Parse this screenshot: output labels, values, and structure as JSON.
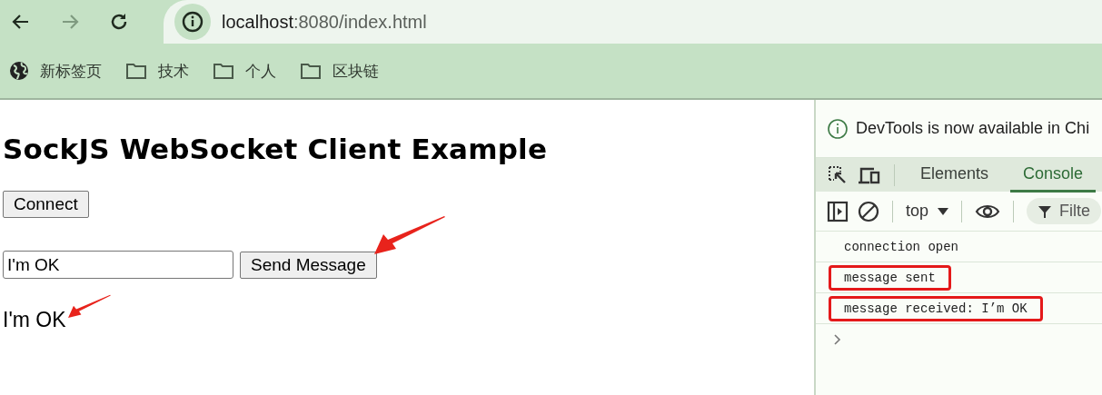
{
  "browser": {
    "nav": {
      "back_disabled": false,
      "forward_disabled": true
    },
    "address": {
      "host": "localhost",
      "rest": ":8080/index.html"
    },
    "bookmarks": [
      {
        "label": "新标签页",
        "kind": "globe"
      },
      {
        "label": "技术",
        "kind": "folder"
      },
      {
        "label": "个人",
        "kind": "folder"
      },
      {
        "label": "区块链",
        "kind": "folder"
      }
    ]
  },
  "page": {
    "heading": "SockJS WebSocket Client Example",
    "connect_button": {
      "label": "Connect"
    },
    "message_input": {
      "value": "I'm OK"
    },
    "send_button": {
      "label": "Send Message",
      "arrow": true
    },
    "received": {
      "text": "I'm OK",
      "arrow": true
    }
  },
  "devtools": {
    "notice": "DevTools is now available in Chi",
    "tabs": [
      {
        "label": "Elements",
        "selected": false
      },
      {
        "label": "Console",
        "selected": true
      }
    ],
    "context": "top",
    "filter": {
      "placeholder": "Filte"
    },
    "messages": [
      {
        "text": "connection open",
        "highlighted": false
      },
      {
        "text": "message sent",
        "highlighted": true
      },
      {
        "text": "message received: I’m OK",
        "highlighted": true
      }
    ]
  }
}
